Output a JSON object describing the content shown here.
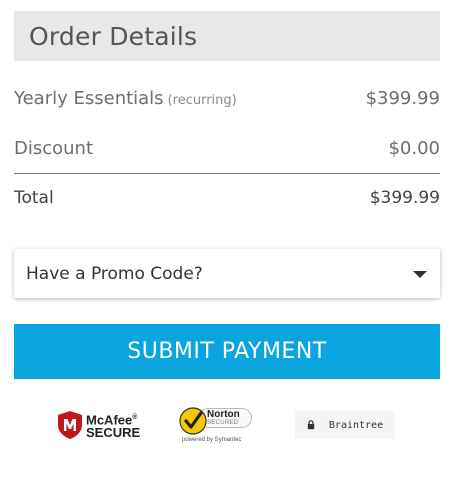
{
  "header": {
    "title": "Order Details"
  },
  "line_items": [
    {
      "label": "Yearly Essentials",
      "note": "(recurring)",
      "amount": "$399.99"
    },
    {
      "label": "Discount",
      "note": "",
      "amount": "$0.00"
    }
  ],
  "total": {
    "label": "Total",
    "amount": "$399.99"
  },
  "promo": {
    "label": "Have a Promo Code?",
    "icon": "chevron-down-icon"
  },
  "submit": {
    "label": "SUBMIT PAYMENT",
    "color": "#0aa5df"
  },
  "badges": {
    "mcafee": {
      "line1": "McAfee",
      "line2": "SECURE",
      "registered": "®"
    },
    "norton": {
      "line1": "Norton",
      "line2": "SECURED",
      "line3": "powered by Symantec"
    },
    "braintree": {
      "label": "Braintree",
      "icon": "lock-icon"
    }
  }
}
